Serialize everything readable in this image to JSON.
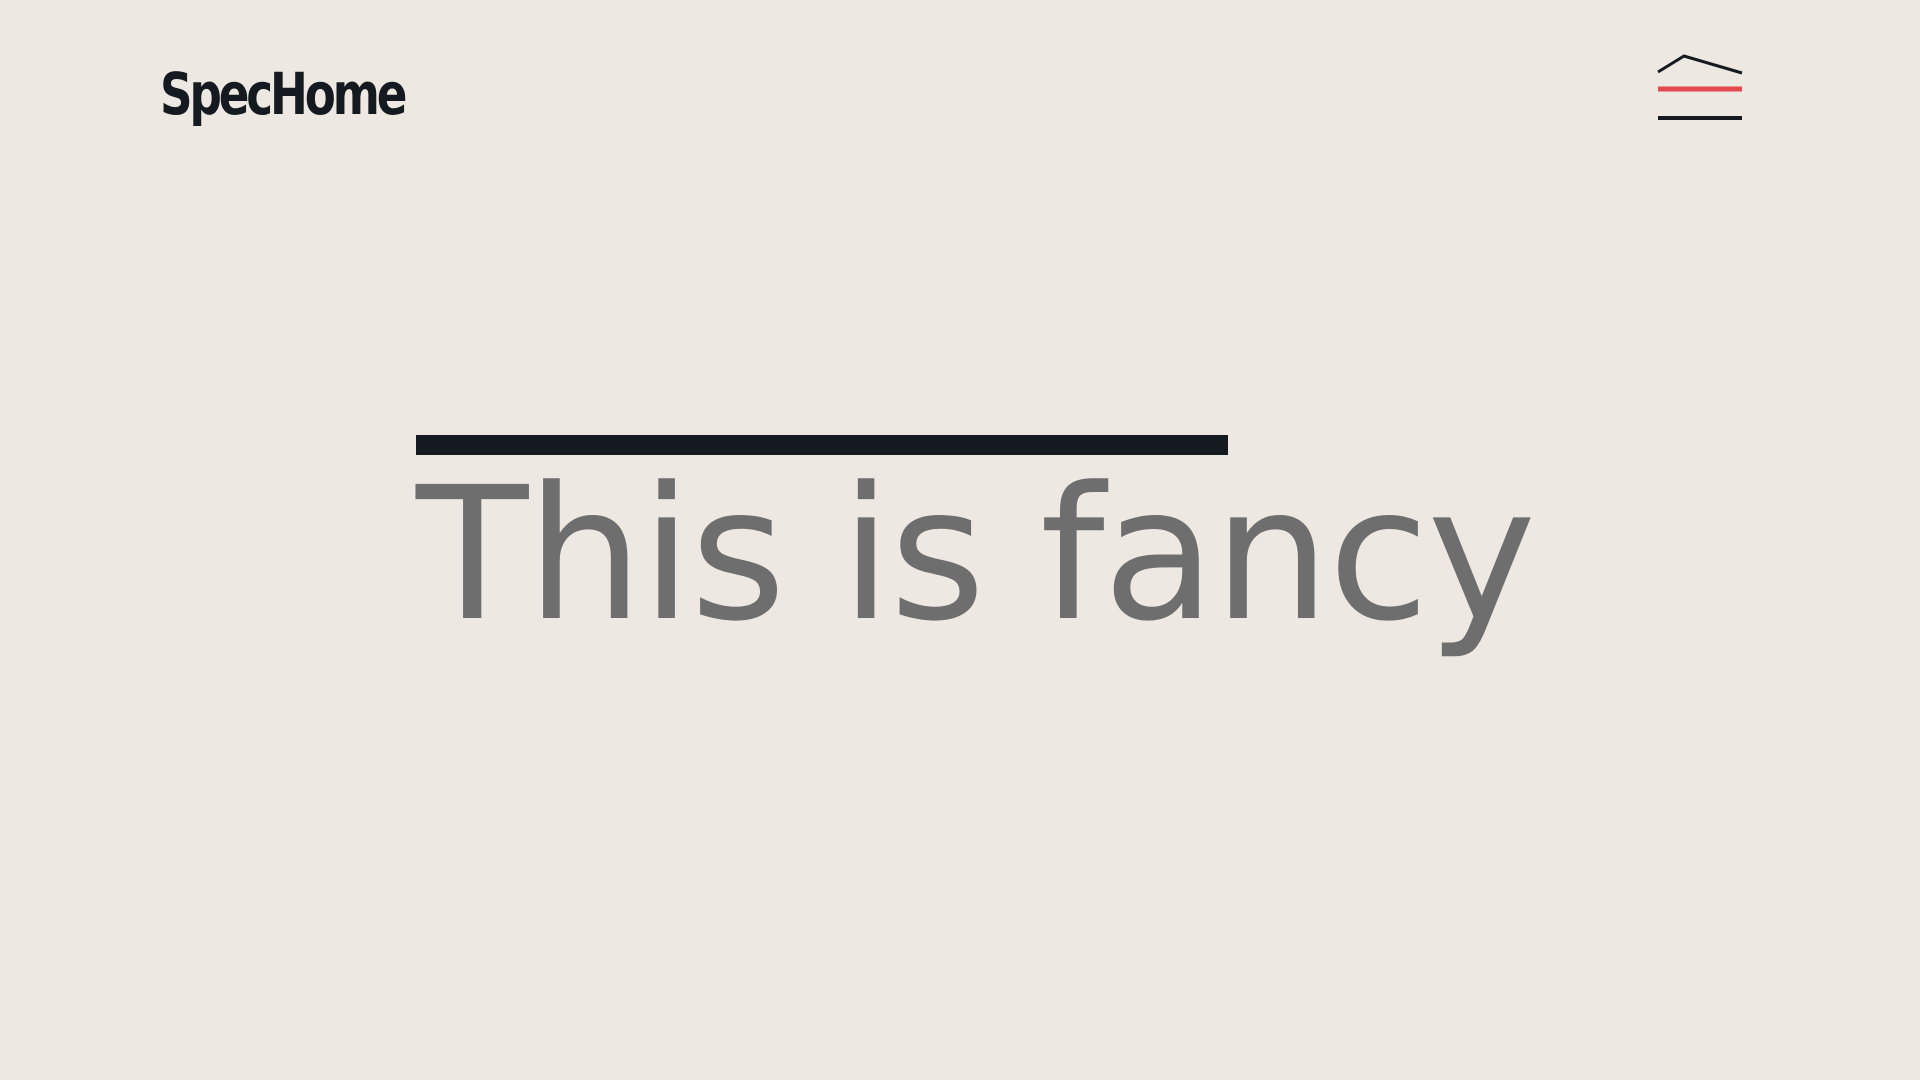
{
  "header": {
    "logo_text": "SpecHome",
    "menu_icon": "house-hamburger-icon"
  },
  "hero": {
    "title": "This is fancy"
  },
  "colors": {
    "background": "#ede8e2",
    "ink": "#141a20",
    "accent": "#e5484d",
    "title_gray": "#6e6e6e"
  }
}
